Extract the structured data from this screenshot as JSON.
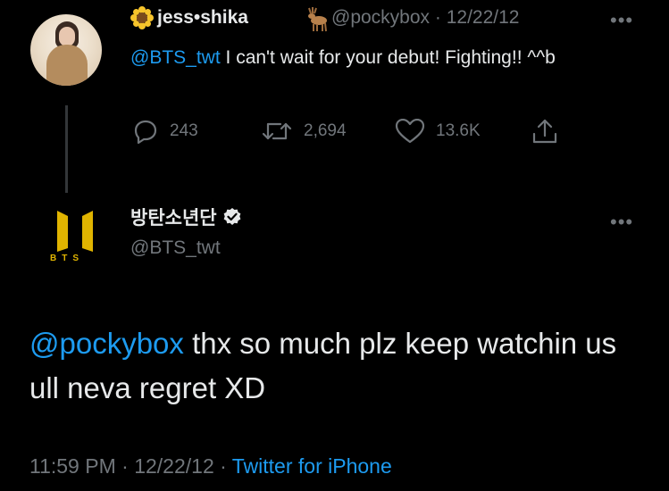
{
  "reply_to": {
    "display_name": "jess•shika",
    "name_prefix_emoji": "sunflower-icon",
    "name_suffix_emoji": "deer-icon",
    "handle": "@pockybox",
    "separator": "·",
    "date": "12/22/12",
    "mention": "@BTS_twt",
    "text": " I can't wait for your debut! Fighting!! ^^b",
    "replies": "243",
    "retweets": "2,694",
    "likes": "13.6K",
    "more": "•••"
  },
  "tweet": {
    "display_name": "방탄소년단",
    "verified": true,
    "handle": "@BTS_twt",
    "logo_text": "BTS",
    "more": "•••",
    "mention": "@pockybox",
    "text": " thx so much plz keep watchin us ull neva regret XD",
    "time": "11:59 PM",
    "separator": "·",
    "date": "12/22/12",
    "source": "Twitter for iPhone"
  },
  "colors": {
    "background": "#000000",
    "text": "#e7e9ea",
    "muted": "#71767b",
    "link": "#1d9bf0",
    "bts_gold": "#e0b400"
  }
}
